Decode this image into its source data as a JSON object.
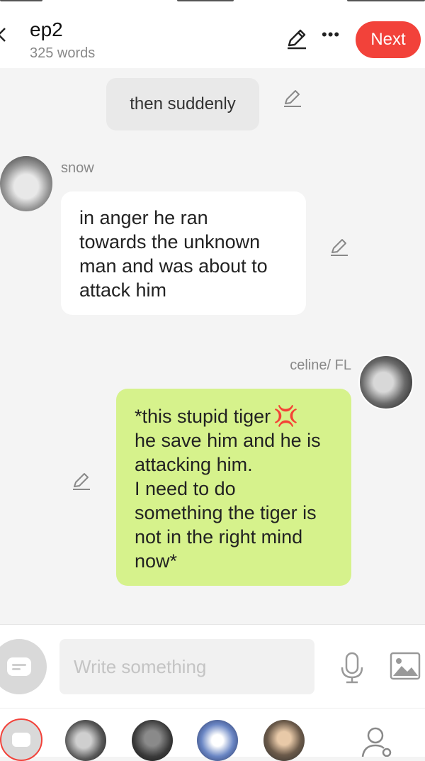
{
  "header": {
    "title": "ep2",
    "word_count": "325 words",
    "next_label": "Next",
    "accent_color": "#f2423a"
  },
  "messages": [
    {
      "type": "narration",
      "text": "then suddenly"
    },
    {
      "type": "incoming",
      "speaker": "snow",
      "text": "in anger he ran\ntowards the unknown\nman and was about to\nattack him"
    },
    {
      "type": "outgoing",
      "speaker": "celine/ FL",
      "text": "*this stupid tiger",
      "emoji": "anger-symbol",
      "text_rest": "he save him and he is\nattacking him.\nI need to do\nsomething the tiger is\nnot in the right mind\nnow*",
      "bubble_color": "#d6f28c"
    }
  ],
  "input": {
    "placeholder": "Write something"
  },
  "icons": {
    "back": "chevron-left-icon",
    "edit": "pencil-icon",
    "more": "more-dots-icon",
    "mic": "microphone-icon",
    "image": "image-icon",
    "settings": "character-settings-icon"
  }
}
